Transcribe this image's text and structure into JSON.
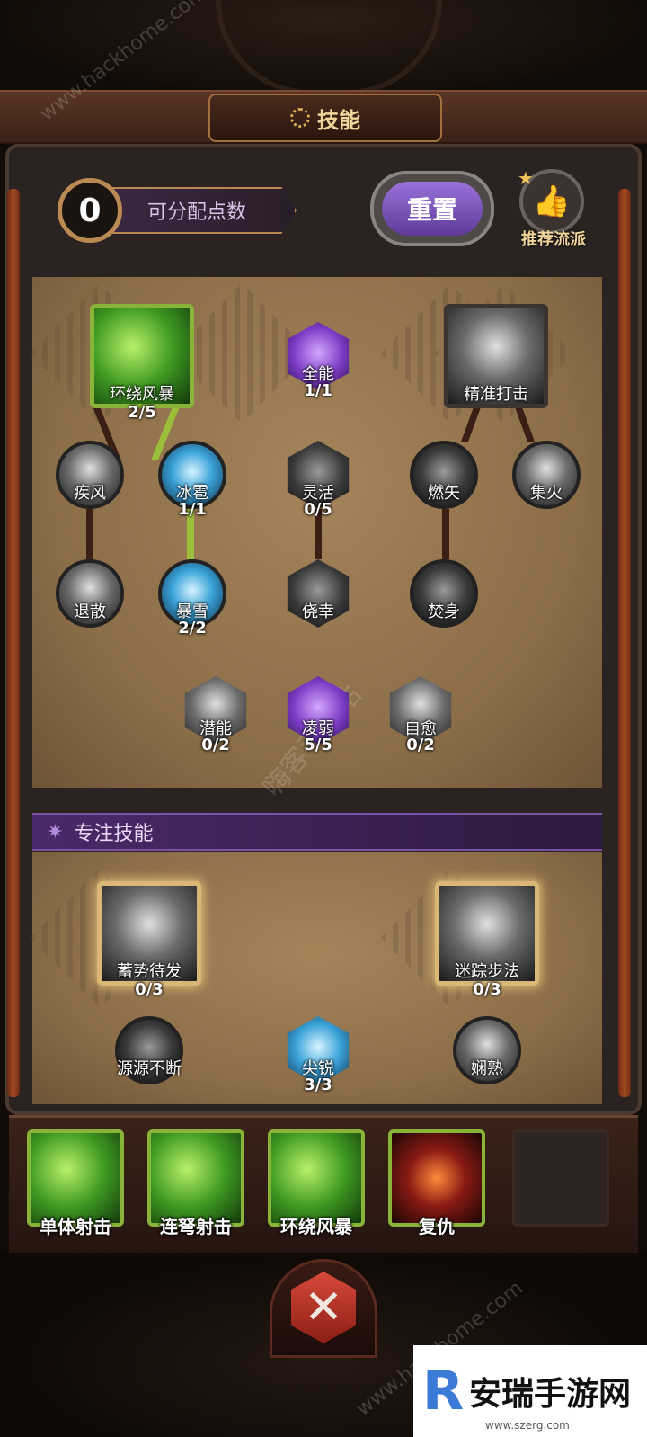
{
  "header": {
    "title": "技能"
  },
  "points": {
    "value": "0",
    "label": "可分配点数"
  },
  "buttons": {
    "reset": "重置",
    "recommend": "推荐流派"
  },
  "tree": {
    "nodes": [
      {
        "id": "huanrao",
        "name": "环绕风暴",
        "level": "2/5"
      },
      {
        "id": "quanneng",
        "name": "全能",
        "level": "1/1"
      },
      {
        "id": "jingzhun",
        "name": "精准打击",
        "level": ""
      },
      {
        "id": "jifeng",
        "name": "疾风",
        "level": ""
      },
      {
        "id": "bingbao",
        "name": "冰雹",
        "level": "1/1"
      },
      {
        "id": "linghuo",
        "name": "灵活",
        "level": "0/5"
      },
      {
        "id": "ranshi",
        "name": "燃矢",
        "level": ""
      },
      {
        "id": "jihuo",
        "name": "集火",
        "level": ""
      },
      {
        "id": "tuisan",
        "name": "退散",
        "level": ""
      },
      {
        "id": "baoxue",
        "name": "暴雪",
        "level": "2/2"
      },
      {
        "id": "jiaoxing",
        "name": "侥幸",
        "level": ""
      },
      {
        "id": "fenshen",
        "name": "焚身",
        "level": ""
      },
      {
        "id": "qianneng",
        "name": "潜能",
        "level": "0/2"
      },
      {
        "id": "lingruo",
        "name": "凌弱",
        "level": "5/5"
      },
      {
        "id": "ziyu",
        "name": "自愈",
        "level": "0/2"
      }
    ]
  },
  "focus": {
    "title": "专注技能",
    "nodes": [
      {
        "id": "xushi",
        "name": "蓄势待发",
        "level": "0/3"
      },
      {
        "id": "mizong",
        "name": "迷踪步法",
        "level": "0/3"
      },
      {
        "id": "yuanyuan",
        "name": "源源不断",
        "level": ""
      },
      {
        "id": "jianrui",
        "name": "尖锐",
        "level": "3/3"
      },
      {
        "id": "xianshu",
        "name": "娴熟",
        "level": ""
      }
    ]
  },
  "slots": [
    {
      "name": "单体射击"
    },
    {
      "name": "连弩射击"
    },
    {
      "name": "环绕风暴"
    },
    {
      "name": "复仇"
    },
    {
      "name": ""
    }
  ],
  "watermarks": {
    "site": "www.hackhome.com",
    "center": "嗨客手机站"
  },
  "corner_logo": {
    "brand": "安瑞手游网",
    "url": "www.szerg.com"
  },
  "colors": {
    "active_line": "#9bbf3a",
    "inactive_line": "#3b1e14",
    "accent_purple": "#7a52a4",
    "gold": "#b98a52"
  }
}
